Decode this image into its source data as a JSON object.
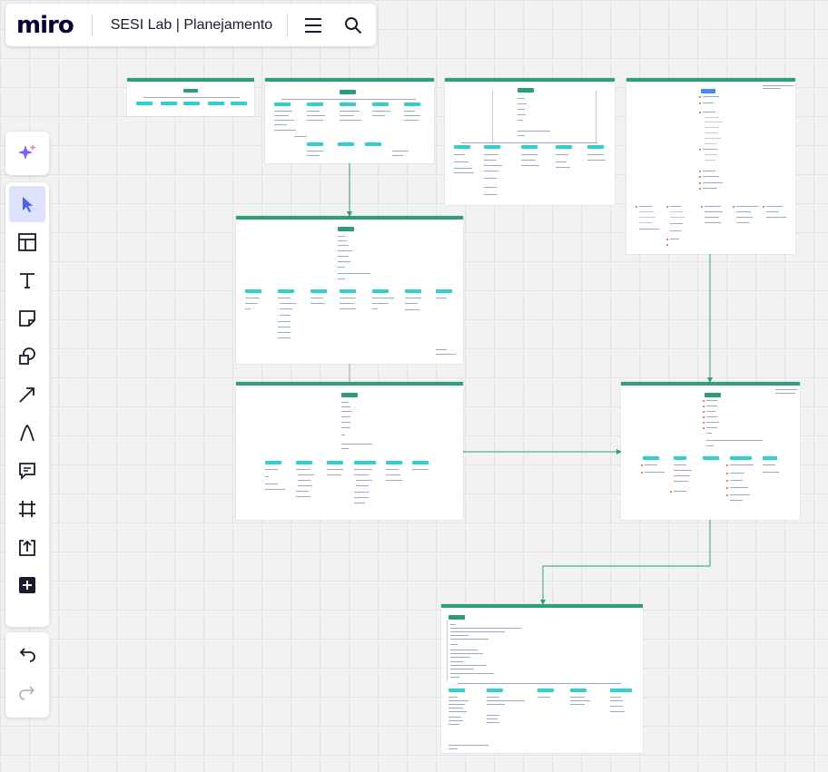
{
  "app": {
    "logo": "miro",
    "board_title": "SESI Lab | Planejamento"
  },
  "topbar": {
    "menu_icon": "hamburger-icon",
    "search_icon": "search-icon"
  },
  "tools": [
    {
      "name": "ai-assistant",
      "icon": "sparkle-icon",
      "color": "#7b61ff"
    },
    {
      "name": "select",
      "icon": "cursor-icon",
      "active": true
    },
    {
      "name": "templates",
      "icon": "templates-icon"
    },
    {
      "name": "text",
      "icon": "text-icon"
    },
    {
      "name": "sticky-note",
      "icon": "sticky-note-icon"
    },
    {
      "name": "shapes",
      "icon": "shapes-icon"
    },
    {
      "name": "connection-line",
      "icon": "arrow-icon"
    },
    {
      "name": "pen",
      "icon": "pen-icon"
    },
    {
      "name": "comment",
      "icon": "comment-icon"
    },
    {
      "name": "frame",
      "icon": "frame-icon"
    },
    {
      "name": "upload",
      "icon": "upload-icon"
    },
    {
      "name": "more-apps",
      "icon": "plus-icon"
    }
  ],
  "history": [
    {
      "name": "undo",
      "icon": "undo-icon"
    },
    {
      "name": "redo",
      "icon": "redo-icon",
      "disabled": true
    }
  ],
  "colors": {
    "frame_header": "#2d9f7c",
    "node": "#2fcfcb",
    "node_dark": "#2a9d78",
    "node_blue": "#3f8ef7",
    "connector": "#2d9f7c",
    "accent": "#4262ff"
  }
}
